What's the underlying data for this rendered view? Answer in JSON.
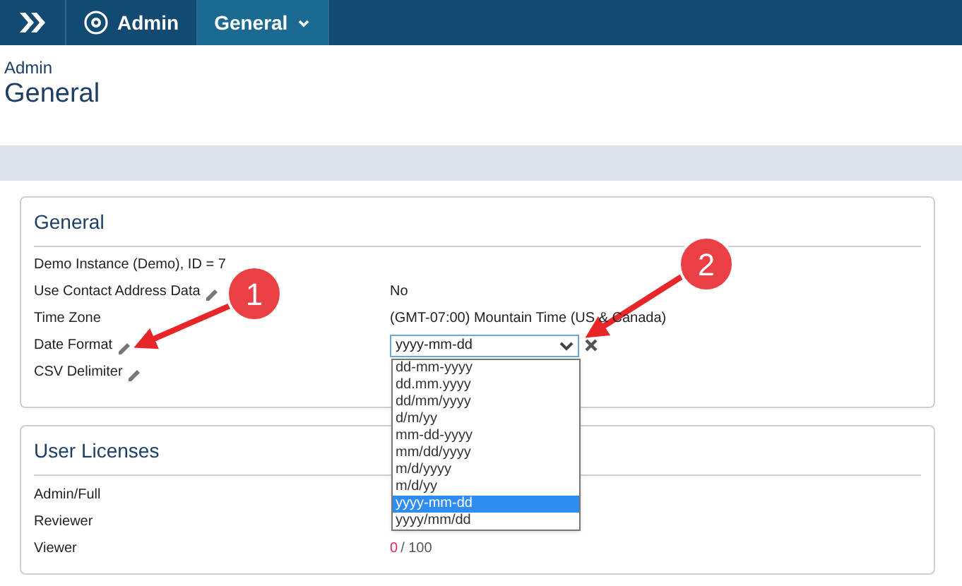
{
  "breadcrumbs": [
    {
      "kind": "home"
    },
    {
      "kind": "gear",
      "label": "Admin",
      "selected": false
    },
    {
      "kind": "menu",
      "label": "General",
      "selected": true
    }
  ],
  "page_header": {
    "section": "Admin",
    "title": "General"
  },
  "general": {
    "title": "General",
    "rows": [
      {
        "label": "Demo Instance (Demo), ID = 7",
        "editable": false,
        "kind": "text"
      },
      {
        "label": "Use Contact Address Data",
        "editable": true,
        "kind": "value",
        "value": "No"
      },
      {
        "label": "Time Zone",
        "editable": false,
        "kind": "value",
        "value": "(GMT-07:00) Mountain Time (US & Canada)"
      },
      {
        "label": "Date Format",
        "editable": true,
        "kind": "select",
        "value": "yyyy-mm-dd",
        "expanded": true,
        "options": [
          {
            "label": "dd-mm-yyyy",
            "selected": false
          },
          {
            "label": "dd.mm.yyyy",
            "selected": false
          },
          {
            "label": "dd/mm/yyyy",
            "selected": false
          },
          {
            "label": "d/m/yy",
            "selected": false
          },
          {
            "label": "mm-dd-yyyy",
            "selected": false
          },
          {
            "label": "mm/dd/yyyy",
            "selected": false
          },
          {
            "label": "m/d/yyyy",
            "selected": false
          },
          {
            "label": "m/d/yy",
            "selected": false
          },
          {
            "label": "yyyy-mm-dd",
            "selected": true
          },
          {
            "label": "yyyy/mm/dd",
            "selected": false
          }
        ]
      },
      {
        "label": "CSV Delimiter",
        "editable": true,
        "kind": "text"
      }
    ]
  },
  "user_licenses": {
    "title": "User Licenses",
    "rows": [
      {
        "label": "Admin/Full"
      },
      {
        "label": "Reviewer"
      },
      {
        "label": "Viewer",
        "used": "0",
        "limit": "/ 100"
      }
    ]
  },
  "callouts": [
    "1",
    "2"
  ]
}
